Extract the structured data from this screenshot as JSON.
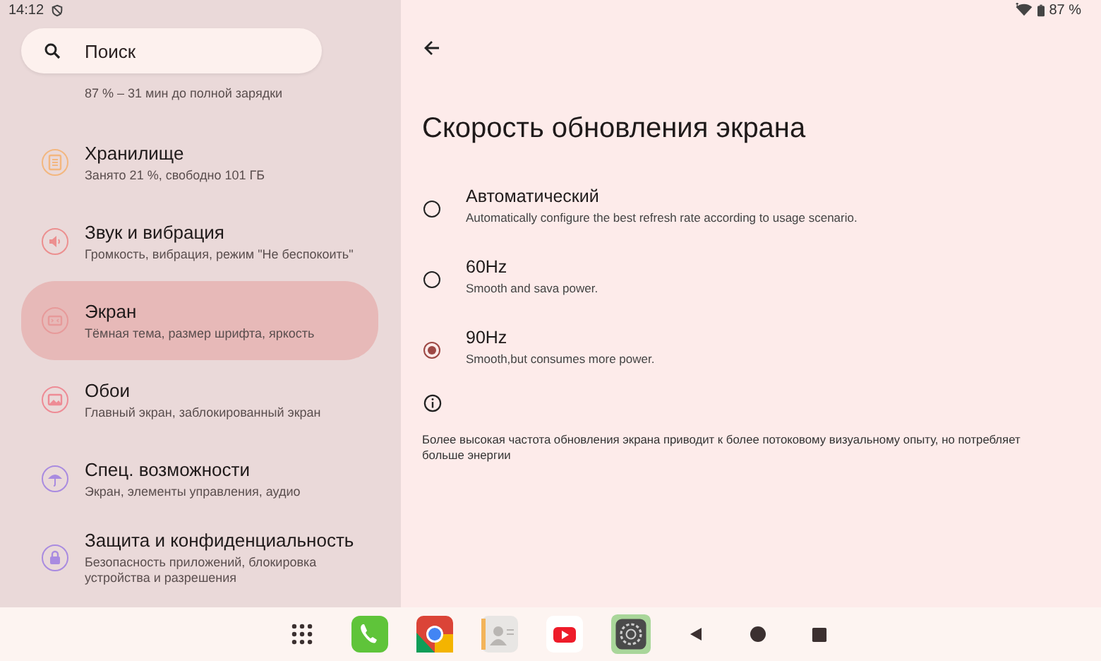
{
  "status_bar": {
    "time": "14:12",
    "battery": "87 %"
  },
  "search": {
    "placeholder": "Поиск"
  },
  "sidebar": {
    "items": [
      {
        "subtitle": "87 % – 31 мин до полной зарядки",
        "selected": false,
        "kind": "partial"
      },
      {
        "title": "Хранилище",
        "subtitle": "Занято 21 %, свободно 101 ГБ",
        "selected": false,
        "kind": "storage",
        "color": "#f3b77f"
      },
      {
        "title": "Звук и вибрация",
        "subtitle": "Громкость, вибрация, режим \"Не беспокоить\"",
        "selected": false,
        "kind": "sound",
        "color": "#ec8f8f"
      },
      {
        "title": "Экран",
        "subtitle": "Тёмная тема, размер шрифта, яркость",
        "selected": true,
        "kind": "screen",
        "color": "#e79a9a"
      },
      {
        "title": "Обои",
        "subtitle": "Главный экран, заблокированный экран",
        "selected": false,
        "kind": "wallpaper",
        "color": "#ee8b95"
      },
      {
        "title": "Спец. возможности",
        "subtitle": "Экран, элементы управления, аудио",
        "selected": false,
        "kind": "accessibility",
        "color": "#a98be0"
      },
      {
        "title": "Защита и конфиденциальность",
        "subtitle": "Безопасность приложений, блокировка устройства и разрешения",
        "selected": false,
        "kind": "security",
        "color": "#a98be0"
      }
    ]
  },
  "page": {
    "title": "Скорость обновления экрана",
    "options": [
      {
        "label": "Автоматический",
        "description": "Automatically configure the best refresh rate according to usage scenario.",
        "selected": false
      },
      {
        "label": "60Hz",
        "description": "Smooth and sava power.",
        "selected": false
      },
      {
        "label": "90Hz",
        "description": "Smooth,but consumes more power.",
        "selected": true
      }
    ],
    "info": "Более высокая частота обновления экрана приводит к более потоковому визуальному опыту, но потребляет больше энергии"
  },
  "navbar": {
    "apps": [
      {
        "kind": "grid"
      },
      {
        "kind": "phone"
      },
      {
        "kind": "chrome"
      },
      {
        "kind": "contacts"
      },
      {
        "kind": "youtube"
      },
      {
        "kind": "settings",
        "selected": true
      }
    ]
  }
}
